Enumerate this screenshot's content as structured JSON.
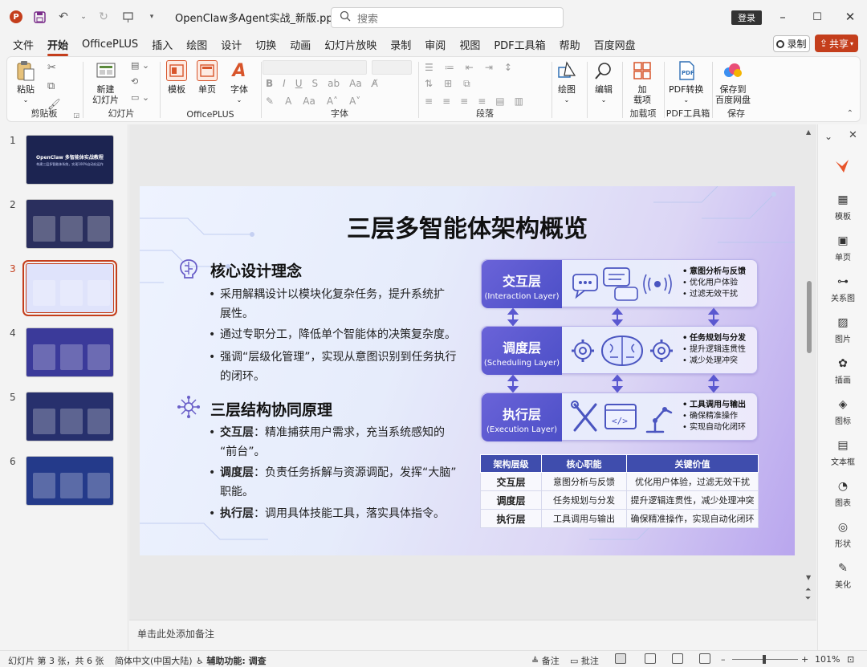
{
  "window": {
    "doc_title": "OpenClaw多Agent实战_新版.pptx  -  PowerPo...",
    "search_placeholder": "搜索",
    "login_label": "登录",
    "minimize": "–",
    "maximize": "☐",
    "close": "✕"
  },
  "menu": {
    "tabs": [
      "文件",
      "开始",
      "OfficePLUS",
      "插入",
      "绘图",
      "设计",
      "切换",
      "动画",
      "幻灯片放映",
      "录制",
      "审阅",
      "视图",
      "PDF工具箱",
      "帮助",
      "百度网盘"
    ],
    "active_index": 1,
    "record_label": "录制",
    "share_label": "共享"
  },
  "ribbon": {
    "groups": {
      "clipboard": "剪贴板",
      "slides": "幻灯片",
      "officeplus": "OfficePLUS",
      "font": "字体",
      "paragraph": "段落",
      "addins": "加载项",
      "pdf": "PDF工具箱",
      "save": "保存"
    },
    "buttons": {
      "paste": "粘贴",
      "new_slide_1": "新建",
      "new_slide_2": "幻灯片",
      "template": "模板",
      "single_page": "单页",
      "font_btn": "字体",
      "draw": "绘图",
      "edit": "编辑",
      "addin_1": "加",
      "addin_2": "载项",
      "pdf_convert": "PDF转换",
      "save_to_1": "保存到",
      "save_to_2": "百度网盘"
    }
  },
  "thumbnails": [
    {
      "num": "1",
      "title": "OpenClaw 多智能体实战教程",
      "sub": "构建三层多智能体系统，实现100%自动化运作",
      "bg": "#1c2451"
    },
    {
      "num": "2",
      "title": "",
      "sub": "",
      "bg": "#2a2f5e"
    },
    {
      "num": "3",
      "title": "",
      "sub": "",
      "bg": "#dfe3fb"
    },
    {
      "num": "4",
      "title": "",
      "sub": "",
      "bg": "#3b3a9a"
    },
    {
      "num": "5",
      "title": "",
      "sub": "",
      "bg": "#27306d"
    },
    {
      "num": "6",
      "title": "",
      "sub": "",
      "bg": "#243a8a"
    }
  ],
  "active_slide": 3,
  "slide": {
    "title": "三层多智能体架构概览",
    "section1": {
      "heading": "核心设计理念",
      "bullets": [
        "采用解耦设计以模块化复杂任务，提升系统扩",
        "展性。",
        "通过专职分工，降低单个智能体的决策复杂度。",
        "强调“层级化管理”，实现从意图识别到任务执行",
        "的闭环。"
      ]
    },
    "section2": {
      "heading": "三层结构协同原理",
      "items": [
        {
          "term": "交互层",
          "text": "：精准捕获用户需求，充当系统感知的",
          "cont": "“前台”。"
        },
        {
          "term": "调度层",
          "text": "：负责任务拆解与资源调配，发挥“大脑”",
          "cont": "职能。"
        },
        {
          "term": "执行层",
          "text": "：调用具体技能工具，落实具体指令。",
          "cont": ""
        }
      ]
    },
    "layers": [
      {
        "name": "交互层",
        "en": "(Interaction Layer)",
        "points": [
          "意图分析与反馈",
          "优化用户体验",
          "过滤无效干扰"
        ],
        "icon": "chat-bubbles-icon"
      },
      {
        "name": "调度层",
        "en": "(Scheduling Layer)",
        "points": [
          "任务规划与分发",
          "提升逻辑连贯性",
          "减少处理冲突"
        ],
        "icon": "brain-gears-icon"
      },
      {
        "name": "执行层",
        "en": "(Execution Layer)",
        "points": [
          "工具调用与输出",
          "确保精准操作",
          "实现自动化闭环"
        ],
        "icon": "tools-robot-arm-icon"
      }
    ],
    "table": {
      "headers": [
        "架构层级",
        "核心职能",
        "关键价值"
      ],
      "rows": [
        [
          "交互层",
          "意图分析与反馈",
          "优化用户体验，过滤无效干扰"
        ],
        [
          "调度层",
          "任务规划与分发",
          "提升逻辑连贯性，减少处理冲突"
        ],
        [
          "执行层",
          "工具调用与输出",
          "确保精准操作，实现自动化闭环"
        ]
      ]
    }
  },
  "right_pane": [
    "模板",
    "单页",
    "关系图",
    "图片",
    "插画",
    "图标",
    "文本框",
    "图表",
    "形状",
    "美化"
  ],
  "notes_placeholder": "单击此处添加备注",
  "status": {
    "slide_info": "幻灯片 第 3 张，共 6 张",
    "language": "简体中文(中国大陆)",
    "accessibility": "辅助功能: 调查",
    "notes": "备注",
    "comments": "批注",
    "zoom": "101%"
  },
  "colors": {
    "accent": "#c43e1c",
    "layer_tag": "#5a58d0",
    "table_header": "#3f4dad"
  }
}
